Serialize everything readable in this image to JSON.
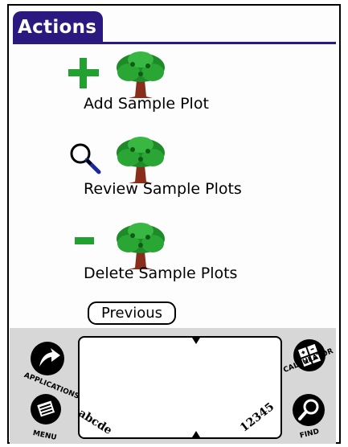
{
  "title": "Actions",
  "actions": [
    {
      "label": "Add Sample Plot",
      "icon": "plus-icon"
    },
    {
      "label": "Review Sample Plots",
      "icon": "magnifier-icon"
    },
    {
      "label": "Delete Sample Plots",
      "icon": "minus-icon"
    }
  ],
  "tree_icon": "tree-icon",
  "previous_label": "Previous",
  "silkscreen": {
    "applications_label": "APPLICATIONS",
    "menu_label": "MENU",
    "calculator_label": "CALCULATOR",
    "find_label": "FIND",
    "alpha_hint": "abcde",
    "numeric_hint": "12345"
  },
  "colors": {
    "title_bar": "#2b1980",
    "plus_minus": "#22a030",
    "tree_canopy": "#1e8a28",
    "tree_trunk": "#8a2e1c",
    "silk_background": "#d7d7d7"
  }
}
